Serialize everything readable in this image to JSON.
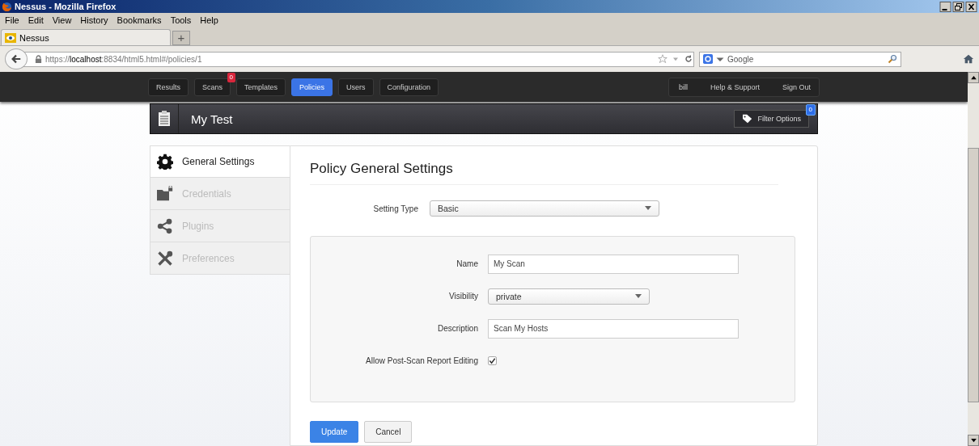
{
  "window": {
    "title": "Nessus - Mozilla Firefox"
  },
  "menu": [
    "File",
    "Edit",
    "View",
    "History",
    "Bookmarks",
    "Tools",
    "Help"
  ],
  "browser_tabs": [
    {
      "label": "Nessus",
      "selected": true
    }
  ],
  "new_tab": "+",
  "url": {
    "scheme": "https://",
    "host": "localhost",
    "rest": ":8834/html5.html#/policies/1"
  },
  "search": {
    "placeholder": "Google"
  },
  "nav": [
    {
      "label": "Results",
      "selected": false
    },
    {
      "label": "Scans",
      "selected": false,
      "badge": "0"
    },
    {
      "label": "Templates",
      "selected": false
    },
    {
      "label": "Policies",
      "selected": true
    },
    {
      "label": "Users",
      "selected": false
    },
    {
      "label": "Configuration",
      "selected": false
    }
  ],
  "user_nav": [
    "bill",
    "Help & Support",
    "Sign Out"
  ],
  "header": {
    "title": "My Test",
    "filter": {
      "label": "Filter Options",
      "badge": "0"
    }
  },
  "sidebar": {
    "items": [
      {
        "label": "General Settings",
        "selected": true
      },
      {
        "label": "Credentials",
        "selected": false
      },
      {
        "label": "Plugins",
        "selected": false
      },
      {
        "label": "Preferences",
        "selected": false
      }
    ]
  },
  "panel": {
    "title": "Policy General Settings",
    "setting_type": {
      "label": "Setting Type",
      "value": "Basic"
    },
    "fields": [
      {
        "kind": "text",
        "label": "Name",
        "value": "My Scan"
      },
      {
        "kind": "select",
        "label": "Visibility",
        "value": "private"
      },
      {
        "kind": "text",
        "label": "Description",
        "value": "Scan My Hosts"
      },
      {
        "kind": "checkbox",
        "label": "Allow Post-Scan Report Editing",
        "checked": true
      }
    ]
  },
  "buttons": [
    {
      "label": "Update",
      "kind": "primary"
    },
    {
      "label": "Cancel",
      "kind": "default"
    }
  ]
}
